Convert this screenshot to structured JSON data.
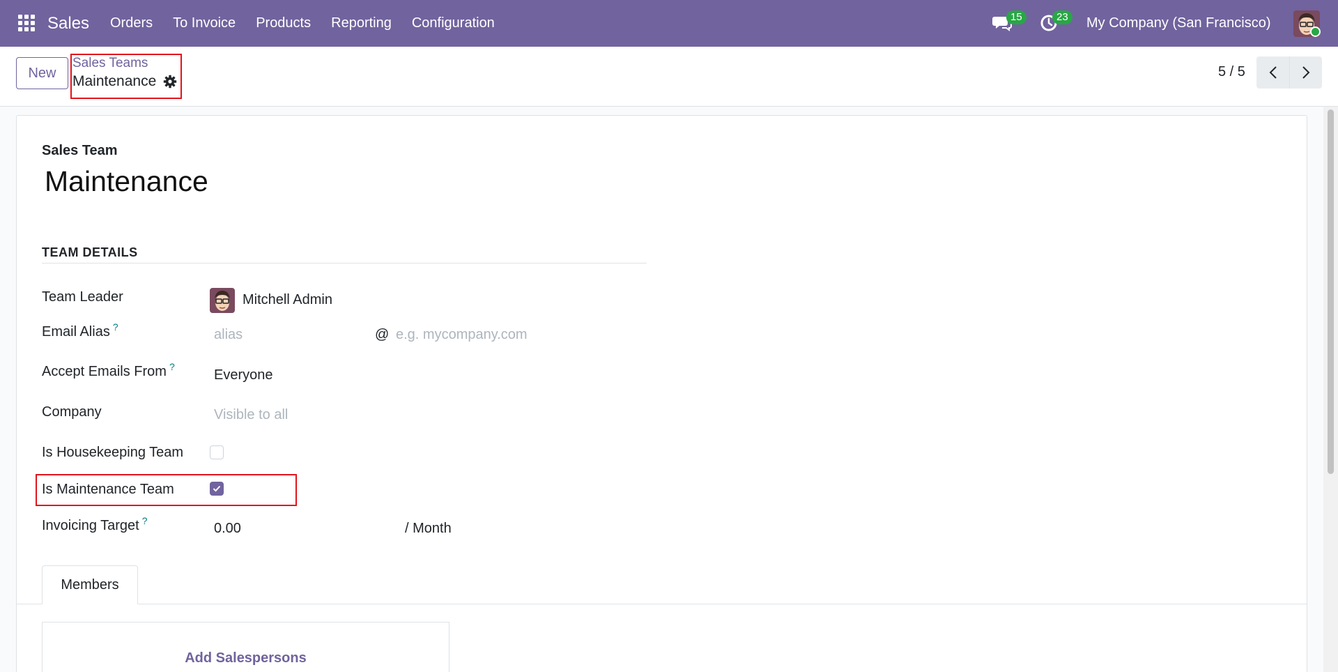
{
  "navbar": {
    "brand": "Sales",
    "menu": [
      "Orders",
      "To Invoice",
      "Products",
      "Reporting",
      "Configuration"
    ],
    "messages_count": "15",
    "activities_count": "23",
    "company": "My Company (San Francisco)"
  },
  "control_panel": {
    "new_label": "New",
    "breadcrumb_parent": "Sales Teams",
    "breadcrumb_current": "Maintenance",
    "pager": "5 / 5"
  },
  "form": {
    "title_label": "Sales Team",
    "name": "Maintenance",
    "section_title": "TEAM DETAILS",
    "fields": {
      "team_leader_label": "Team Leader",
      "team_leader_value": "Mitchell Admin",
      "email_alias_label": "Email Alias",
      "email_alias_placeholder": "alias",
      "email_at": "@",
      "email_domain_placeholder": "e.g. mycompany.com",
      "accept_emails_label": "Accept Emails From",
      "accept_emails_value": "Everyone",
      "company_label": "Company",
      "company_placeholder": "Visible to all",
      "housekeeping_label": "Is Housekeeping Team",
      "housekeeping_checked": false,
      "maintenance_label": "Is Maintenance Team",
      "maintenance_checked": true,
      "invoicing_target_label": "Invoicing Target",
      "invoicing_target_value": "0.00",
      "invoicing_target_period": "/ Month",
      "help_mark": "?"
    },
    "tabs": [
      "Members"
    ],
    "add_salespersons_label": "Add Salespersons"
  },
  "colors": {
    "brand": "#71639e",
    "badge": "#28a745",
    "highlight": "#e3131b",
    "help": "#017e84"
  }
}
